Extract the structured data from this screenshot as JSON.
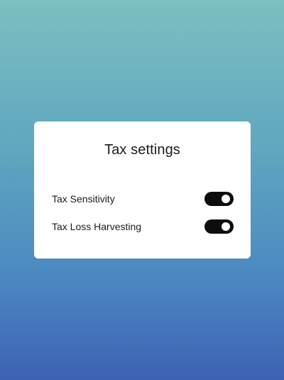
{
  "dialog": {
    "title": "Tax settings",
    "settings": [
      {
        "label": "Tax Sensitivity",
        "enabled": true
      },
      {
        "label": "Tax Loss Harvesting",
        "enabled": true
      }
    ]
  },
  "colors": {
    "background_top": "#7cc0c1",
    "background_bottom": "#3d62b3",
    "card": "#ffffff",
    "toggle_on": "#0c0c0c",
    "text": "#1c1c1c"
  }
}
